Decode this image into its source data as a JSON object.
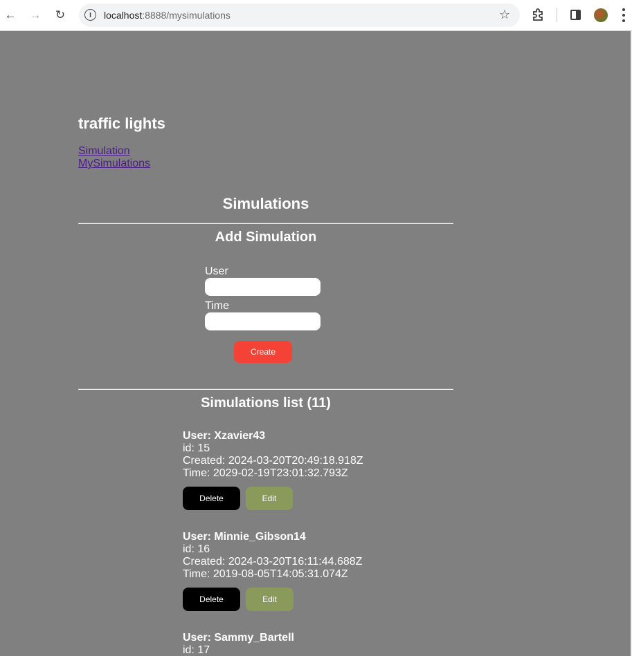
{
  "browser": {
    "url_host": "localhost",
    "url_rest": ":8888/mysimulations"
  },
  "app": {
    "title": "traffic lights",
    "nav": [
      "Simulation",
      "MySimulations"
    ]
  },
  "page": {
    "heading": "Simulations"
  },
  "form": {
    "heading": "Add Simulation",
    "user_label": "User",
    "user_value": "",
    "time_label": "Time",
    "time_value": "",
    "create_label": "Create"
  },
  "list": {
    "heading": "Simulations list (11)",
    "items": [
      {
        "user": "User: Xzavier43",
        "id": "id: 15",
        "created": "Created: 2024-03-20T20:49:18.918Z",
        "time": "Time: 2029-02-19T23:01:32.793Z",
        "delete_label": "Delete",
        "edit_label": "Edit"
      },
      {
        "user": "User: Minnie_Gibson14",
        "id": "id: 16",
        "created": "Created: 2024-03-20T16:11:44.688Z",
        "time": "Time: 2019-08-05T14:05:31.074Z",
        "delete_label": "Delete",
        "edit_label": "Edit"
      },
      {
        "user": "User: Sammy_Bartell",
        "id": "id: 17"
      }
    ]
  }
}
